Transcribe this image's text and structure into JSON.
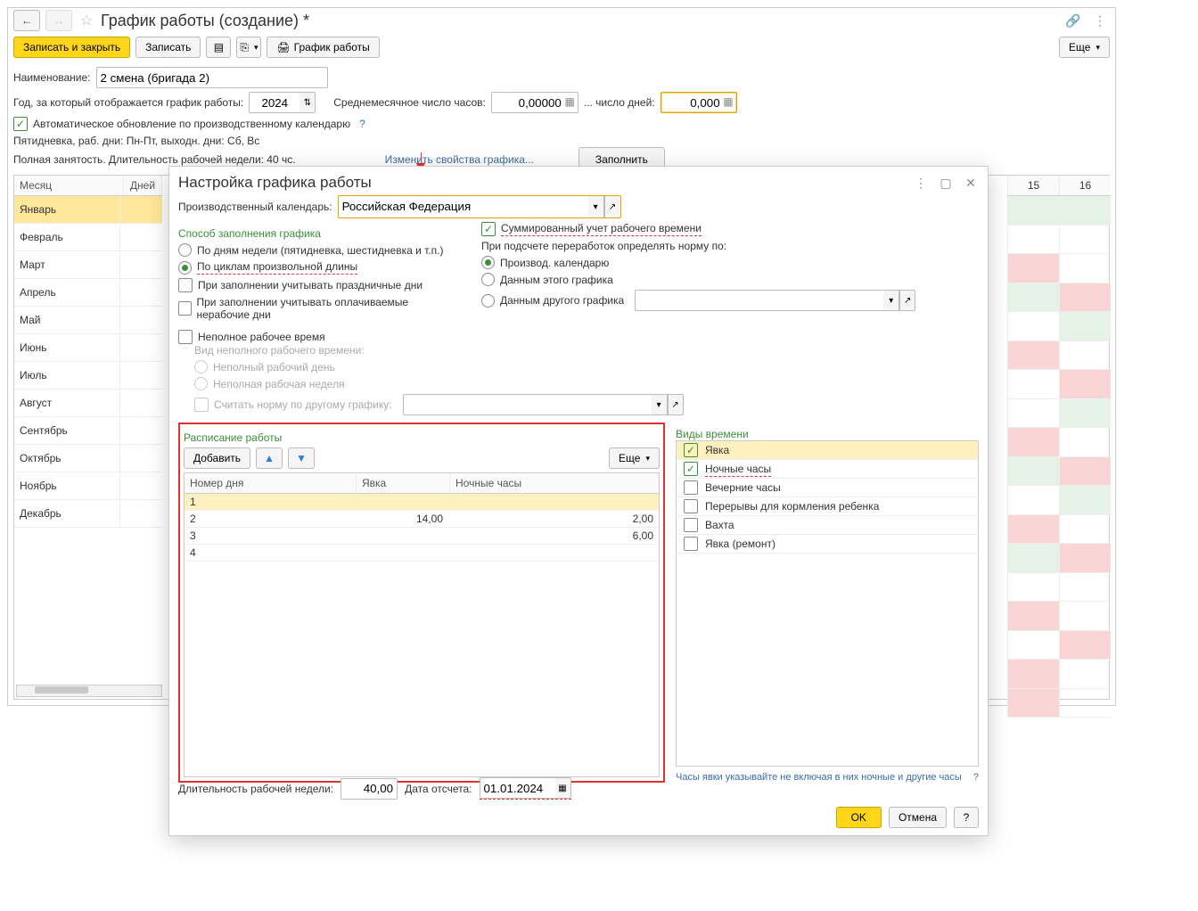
{
  "main": {
    "title": "График работы (создание) *",
    "toolbar": {
      "save_close": "Записать и закрыть",
      "save": "Записать",
      "print_schedule": "График работы",
      "more": "Еще"
    },
    "fields": {
      "name_label": "Наименование:",
      "name_value": "2 смена (бригада 2)",
      "year_label": "Год, за который отображается график работы:",
      "year_value": "2024",
      "avg_hours_label": "Среднемесячное число часов:",
      "avg_hours_value": "0,00000",
      "days_label": "... число дней:",
      "days_value": "0,000",
      "auto_update_label": "Автоматическое обновление по производственному календарю"
    },
    "summary": {
      "line1": "Пятидневка, раб. дни: Пн-Пт, выходн. дни: Сб, Вс",
      "line2": "Полная занятость. Длительность рабочей недели: 40 чс."
    },
    "change_props_link": "Изменить свойства графика...",
    "fill_btn": "Заполнить"
  },
  "months": {
    "col_month": "Месяц",
    "col_days": "Дней",
    "items": [
      "Январь",
      "Февраль",
      "Март",
      "Апрель",
      "Май",
      "Июнь",
      "Июль",
      "Август",
      "Сентябрь",
      "Октябрь",
      "Ноябрь",
      "Декабрь"
    ]
  },
  "calendar_frag": {
    "d15": "15",
    "d16": "16"
  },
  "dialog": {
    "title": "Настройка графика работы",
    "calendar_label": "Производственный календарь:",
    "calendar_value": "Российская Федерация",
    "fill_method_head": "Способ заполнения графика",
    "fill_by_weekdays": "По дням недели (пятидневка, шестидневка и т.п.)",
    "fill_by_cycles": "По циклам произвольной длины",
    "respect_holidays": "При заполнении учитывать праздничные дни",
    "respect_paid_nonwork": "При заполнении учитывать оплачиваемые нерабочие дни",
    "sum_accounting": "Суммированный учет рабочего времени",
    "overtime_label": "При подсчете переработок определять норму по:",
    "ov_calendar": "Производ. календарю",
    "ov_this": "Данным этого графика",
    "ov_other": "Данным другого графика",
    "partial_time": "Неполное рабочее время",
    "partial_kind_label": "Вид неполного рабочего времени:",
    "partial_day": "Неполный рабочий день",
    "partial_week": "Неполная рабочая неделя",
    "count_by_other": "Считать норму по другому графику:",
    "schedule_head": "Расписание работы",
    "add_btn": "Добавить",
    "more_btn": "Еще",
    "col_daynum": "Номер дня",
    "col_appearance": "Явка",
    "col_night": "Ночные часы",
    "rows": [
      {
        "n": "1",
        "a": "",
        "night": ""
      },
      {
        "n": "2",
        "a": "14,00",
        "night": "2,00"
      },
      {
        "n": "3",
        "a": "",
        "night": "6,00"
      },
      {
        "n": "4",
        "a": "",
        "night": ""
      }
    ],
    "time_types_head": "Виды времени",
    "time_types": [
      {
        "label": "Явка",
        "on": true,
        "sel": true
      },
      {
        "label": "Ночные часы",
        "on": true,
        "underline": true
      },
      {
        "label": "Вечерние часы",
        "on": false
      },
      {
        "label": "Перерывы для кормления ребенка",
        "on": false
      },
      {
        "label": "Вахта",
        "on": false
      },
      {
        "label": "Явка (ремонт)",
        "on": false
      }
    ],
    "hint": "Часы явки указывайте не включая в них ночные и другие часы",
    "week_dur_label": "Длительность рабочей недели:",
    "week_dur_value": "40,00",
    "start_date_label": "Дата отсчета:",
    "start_date_value": "01.01.2024",
    "ok": "OK",
    "cancel": "Отмена",
    "help": "?"
  }
}
